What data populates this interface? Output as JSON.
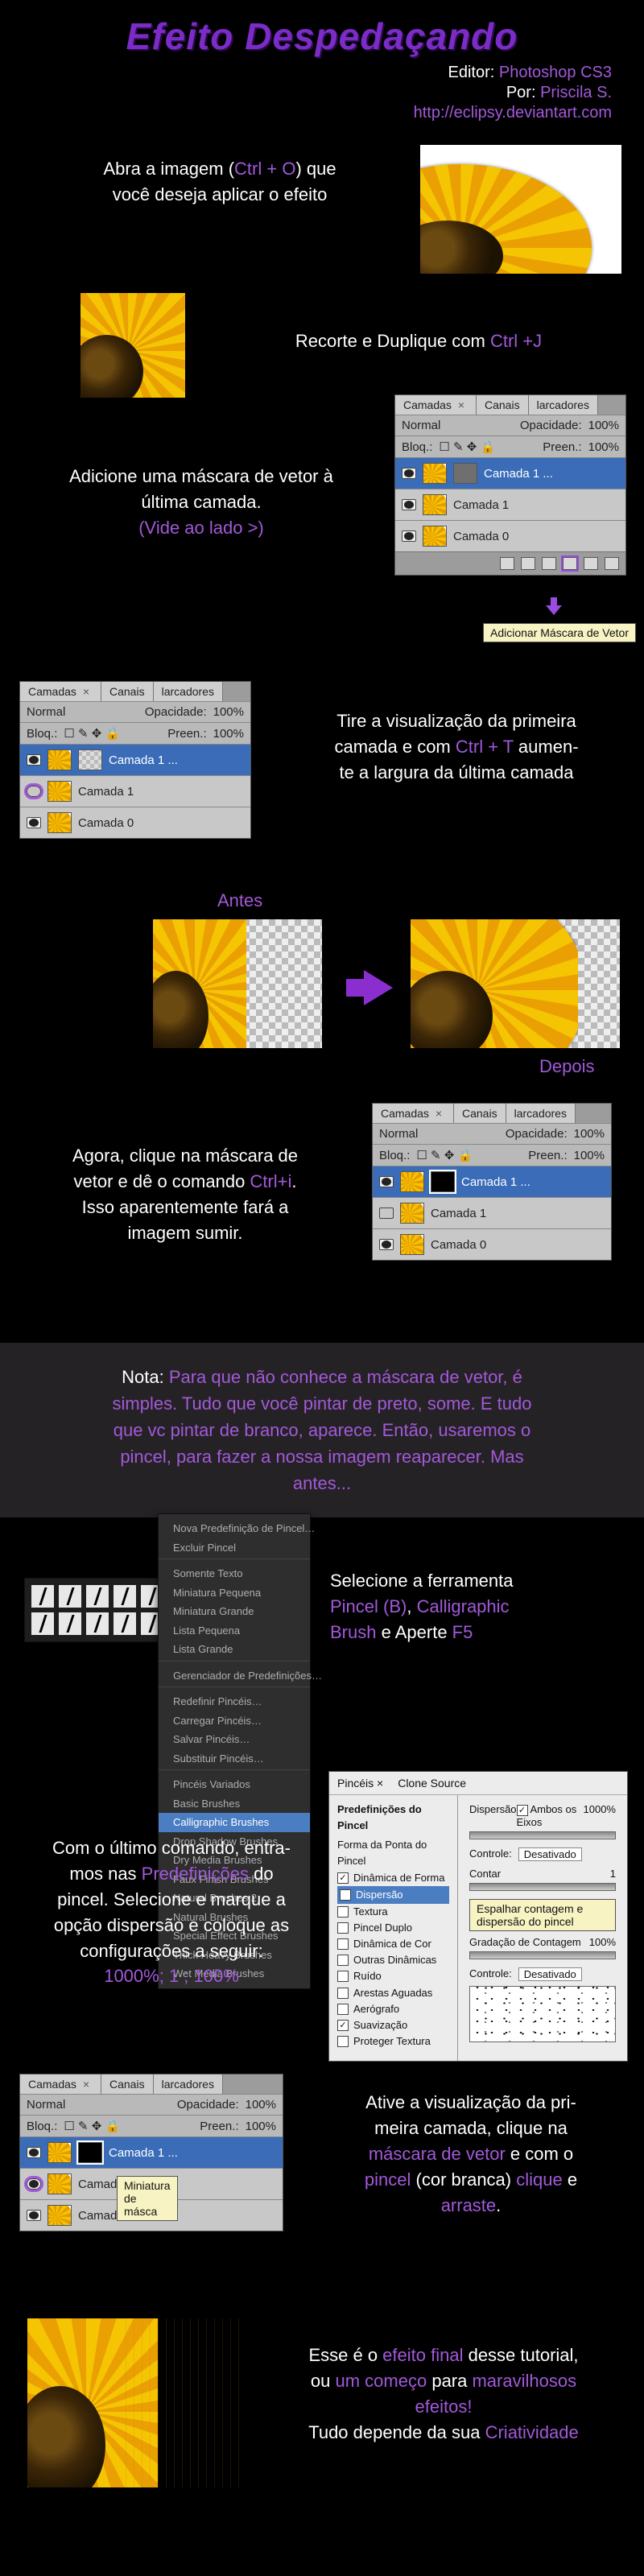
{
  "title": "Efeito Despedaçando",
  "meta": {
    "editor_lbl": "Editor:",
    "editor_val": "Photoshop CS3",
    "by_lbl": "Por:",
    "by_val": "Priscila S.",
    "url": "http://eclipsy.deviantart.com"
  },
  "s1": {
    "a": "Abra a imagem (",
    "cmd": "Ctrl + O",
    "b": ") que",
    "c": "você deseja aplicar o efeito"
  },
  "s2": {
    "a": "Recorte e Duplique com ",
    "cmd": "Ctrl +J"
  },
  "s3": {
    "a": "Adicione uma máscara de vetor à",
    "b": "última camada.",
    "hint": "(Vide ao lado >)"
  },
  "panel": {
    "tabA": "Camadas",
    "tabB": "Canais",
    "tabC": "larcadores",
    "mode": "Normal",
    "opac_lbl": "Opacidade:",
    "opac_val": "100%",
    "lock_lbl": "Bloq.:",
    "fill_lbl": "Preen.:",
    "fill_val": "100%",
    "layers": [
      "Camada 1 ...",
      "Camada 1",
      "Camada 0"
    ],
    "tooltip_addmask": "Adicionar Máscara de Vetor",
    "tooltip_mini": "Miniatura de másca"
  },
  "s4": {
    "a": "Tire a visualização da primeira",
    "b": "camada e com ",
    "cmd": "Ctrl + T",
    "c": " aumen-",
    "d": "te a largura da última camada"
  },
  "labels": {
    "before": "Antes",
    "after": "Depois"
  },
  "s5": {
    "a": "Agora, clique na máscara de",
    "b": "vetor e dê o comando ",
    "cmd": "Ctrl+i",
    "c": ".",
    "d": "Isso aparentemente fará a",
    "e": "imagem sumir."
  },
  "note": {
    "lbl": "Nota:",
    "t1": "Para que não conhece a máscara de vetor, é",
    "t2": "simples. Tudo que você pintar de preto, some. E tudo",
    "t3": "que vc pintar de branco, aparece. Então, usaremos o",
    "t4": "pincel, para fazer a nossa imagem reaparecer. Mas",
    "t5": "antes..."
  },
  "s6": {
    "a": "Selecione a ferramenta",
    "b1": "Pincel (B)",
    "b2": ", ",
    "b3": "Calligraphic",
    "c1": "Brush",
    "c2": " e Aperte ",
    "c3": "F5"
  },
  "menu_items": [
    "Nova Predefinição de Pincel…",
    "Excluir Pincel",
    "Somente Texto",
    "Miniatura Pequena",
    "Miniatura Grande",
    "Lista Pequena",
    "Lista Grande",
    "Gerenciador de Predefinições…",
    "Redefinir Pincéis…",
    "Carregar Pincéis…",
    "Salvar Pincéis…",
    "Substituir Pincéis…",
    "Pincéis Variados",
    "Basic Brushes",
    "Calligraphic Brushes",
    "Drop Shadow Brushes",
    "Dry Media Brushes",
    "Faux Finish Brushes",
    "Natural Brushes 2",
    "Natural Brushes",
    "Special Effect Brushes",
    "Thick Heavy Brushes",
    "Wet Media Brushes"
  ],
  "s7": {
    "a": "Com o último comando, entra-",
    "b1": "mos nas ",
    "b2": "Predefinições",
    "b3": " do",
    "c": "pincel. Selecione e marque a",
    "d": "opção dispersão e coloque as",
    "e": "configurações a seguir:",
    "vals": "1000%; 1 ; 100%"
  },
  "dialog": {
    "tab1": "Pincéis ×",
    "tab2": "Clone Source",
    "side_title": "Predefinições do Pincel",
    "opts": [
      "Forma da Ponta do Pincel",
      "Dinâmica de Forma",
      "Dispersão",
      "Textura",
      "Pincel Duplo",
      "Dinâmica de Cor",
      "Outras Dinâmicas",
      "Ruído",
      "Arestas Aguadas",
      "Aerógrafo",
      "Suavização",
      "Proteger Textura"
    ],
    "disp_lbl": "Dispersão",
    "both_lbl": "Ambos os Eixos",
    "disp_val": "1000%",
    "ctrl_lbl": "Controle:",
    "ctrl_val": "Desativado",
    "count_lbl": "Contar",
    "count_val": "1",
    "tooltip_row": "Espalhar contagem e dispersão do pincel",
    "jitter_lbl": "Gradação de Contagem",
    "jitter_val": "100%"
  },
  "s8": {
    "a": "Ative a visualização da pri-",
    "b": "meira camada, clique na",
    "c": "máscara de vetor",
    "d": " e com o",
    "e": "pincel",
    "f": " (cor branca) ",
    "g": "clique",
    "h": " e",
    "i": "arraste",
    "j": "."
  },
  "final": {
    "a1": "Esse é o ",
    "a2": "efeito final",
    "a3": " desse tutorial,",
    "b1": "ou ",
    "b2": "um começo",
    "b3": " para ",
    "b4": "maravilhosos",
    "c": "efeitos!",
    "d1": "Tudo depende da sua ",
    "d2": "Criatividade"
  }
}
